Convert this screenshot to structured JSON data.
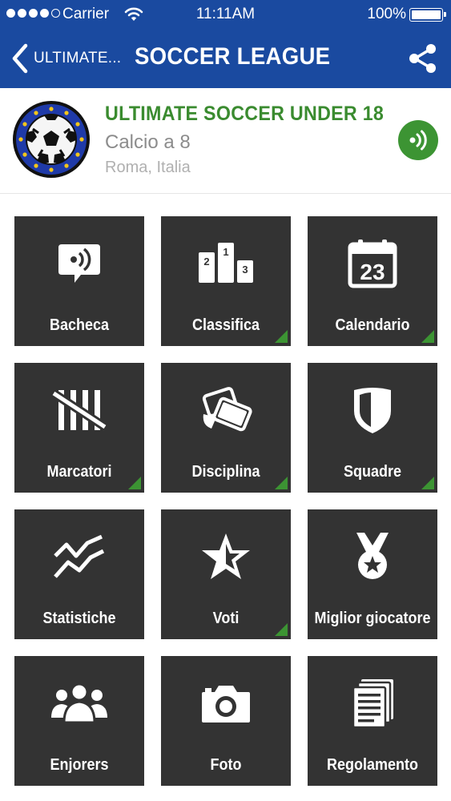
{
  "status_bar": {
    "carrier": "Carrier",
    "time": "11:11AM",
    "battery": "100%"
  },
  "nav": {
    "back_label": "ULTIMATE...",
    "title": "SOCCER LEAGUE"
  },
  "league": {
    "name": "ULTIMATE SOCCER UNDER 18",
    "sport": "Calcio a 8",
    "location": "Roma, Italia"
  },
  "menu": [
    {
      "label": "Bacheca",
      "icon": "chat-bubble-icon",
      "has_indicator": false
    },
    {
      "label": "Classifica",
      "icon": "podium-icon",
      "has_indicator": true
    },
    {
      "label": "Calendario",
      "icon": "calendar-icon",
      "has_indicator": true
    },
    {
      "label": "Marcatori",
      "icon": "tally-marks-icon",
      "has_indicator": true
    },
    {
      "label": "Disciplina",
      "icon": "cards-icon",
      "has_indicator": true
    },
    {
      "label": "Squadre",
      "icon": "shield-icon",
      "has_indicator": true
    },
    {
      "label": "Statistiche",
      "icon": "stats-lines-icon",
      "has_indicator": false
    },
    {
      "label": "Voti",
      "icon": "star-icon",
      "has_indicator": true
    },
    {
      "label": "Miglior  giocatore",
      "icon": "medal-icon",
      "has_indicator": false
    },
    {
      "label": "Enjorers",
      "icon": "people-icon",
      "has_indicator": false
    },
    {
      "label": "Foto",
      "icon": "camera-icon",
      "has_indicator": false
    },
    {
      "label": "Regolamento",
      "icon": "document-icon",
      "has_indicator": false
    }
  ],
  "calendar_icon_day": "23",
  "podium_numbers": [
    "2",
    "1",
    "3"
  ],
  "colors": {
    "nav_bar": "#1a4aa0",
    "accent_green": "#3c9433",
    "league_name": "#3a8b2f",
    "tile_bg": "#333333"
  }
}
